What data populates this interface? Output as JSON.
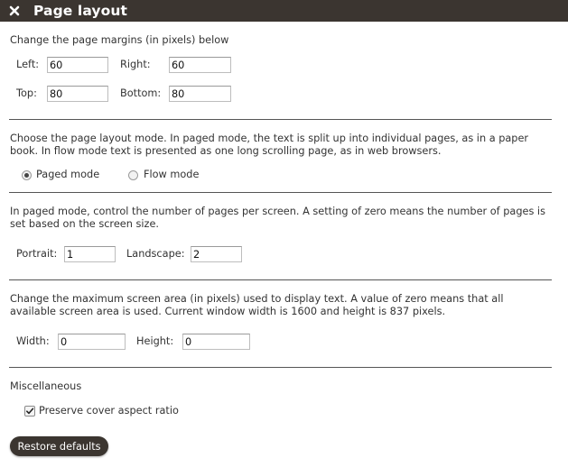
{
  "dialog": {
    "title": "Page layout",
    "close_icon": "close-icon"
  },
  "margins": {
    "description": "Change the page margins (in pixels) below",
    "left_label": "Left:",
    "left_value": "60",
    "right_label": "Right:",
    "right_value": "60",
    "top_label": "Top:",
    "top_value": "80",
    "bottom_label": "Bottom:",
    "bottom_value": "80"
  },
  "layout_mode": {
    "description": "Choose the page layout mode. In paged mode, the text is split up into individual pages, as in a paper book. In flow mode text is presented as one long scrolling page, as in web browsers.",
    "options": [
      {
        "label": "Paged mode",
        "selected": true
      },
      {
        "label": "Flow mode",
        "selected": false
      }
    ]
  },
  "pages_per_screen": {
    "description": "In paged mode, control the number of pages per screen. A setting of zero means the number of pages is set based on the screen size.",
    "portrait_label": "Portrait:",
    "portrait_value": "1",
    "landscape_label": "Landscape:",
    "landscape_value": "2"
  },
  "screen_area": {
    "description": "Change the maximum screen area (in pixels) used to display text. A value of zero means that all available screen area is used. Current window width is 1600 and height is 837 pixels.",
    "width_label": "Width:",
    "width_value": "0",
    "height_label": "Height:",
    "height_value": "0"
  },
  "misc": {
    "heading": "Miscellaneous",
    "preserve_cover_label": "Preserve cover aspect ratio",
    "preserve_cover_checked": true
  },
  "restore_button": "Restore defaults",
  "colors": {
    "titlebar": "#3b3530",
    "button": "#3b3530",
    "divider": "#555555"
  }
}
